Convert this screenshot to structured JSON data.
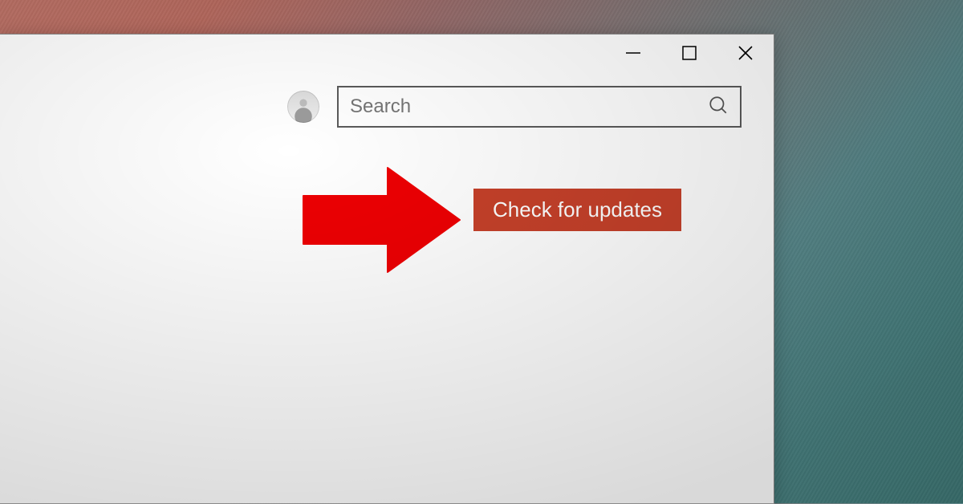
{
  "window": {
    "controls": {
      "minimize": "minimize",
      "maximize": "maximize",
      "close": "close"
    }
  },
  "search": {
    "placeholder": "Search"
  },
  "main": {
    "check_updates_label": "Check for updates"
  },
  "annotation": {
    "arrow_color": "#ee0003"
  },
  "colors": {
    "button_bg": "#c6412a",
    "button_fg": "#ffffff"
  }
}
